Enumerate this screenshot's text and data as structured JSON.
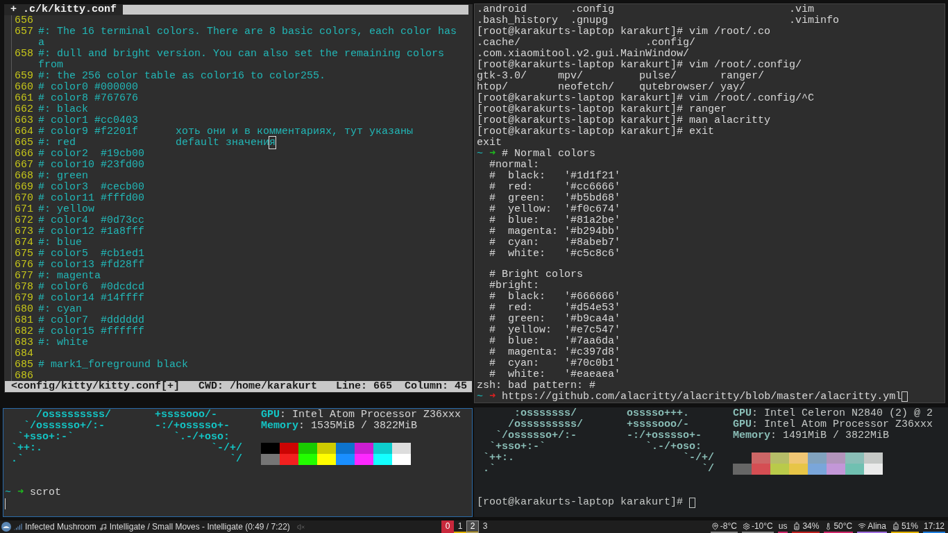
{
  "editor": {
    "tab": "+ .c/k/kitty.conf",
    "lines": [
      {
        "number": "656"
      },
      {
        "number": "657",
        "text": "#: The 16 terminal colors. There are 8 basic colors, each color has a"
      },
      {
        "number": "658",
        "text": "#: dull and bright version. You can also set the remaining colors from"
      },
      {
        "number": "659",
        "text": "#: the 256 color table as color16 to color255."
      },
      {
        "number": "660",
        "text": "# color0 #000000"
      },
      {
        "number": "661",
        "text": "# color8 #767676"
      },
      {
        "number": "662",
        "text": "#: black"
      },
      {
        "number": "663",
        "text": "# color1 #cc0403"
      },
      {
        "number": "664",
        "text": "# color9 #f2201f      хоть они и в комментариях, тут указаны"
      },
      {
        "number": "665",
        "text": "#: red                default значения",
        "cursor": true
      },
      {
        "number": "666",
        "text": "# color2  #19cb00"
      },
      {
        "number": "667",
        "text": "# color10 #23fd00"
      },
      {
        "number": "668",
        "text": "#: green"
      },
      {
        "number": "669",
        "text": "# color3  #cecb00"
      },
      {
        "number": "670",
        "text": "# color11 #fffd00"
      },
      {
        "number": "671",
        "text": "#: yellow"
      },
      {
        "number": "672",
        "text": "# color4  #0d73cc"
      },
      {
        "number": "673",
        "text": "# color12 #1a8fff"
      },
      {
        "number": "674",
        "text": "#: blue"
      },
      {
        "number": "675",
        "text": "# color5  #cb1ed1"
      },
      {
        "number": "676",
        "text": "# color13 #fd28ff"
      },
      {
        "number": "677",
        "text": "#: magenta"
      },
      {
        "number": "678",
        "text": "# color6  #0dcdcd"
      },
      {
        "number": "679",
        "text": "# color14 #14ffff"
      },
      {
        "number": "680",
        "text": "#: cyan"
      },
      {
        "number": "681",
        "text": "# color7  #dddddd"
      },
      {
        "number": "682",
        "text": "# color15 #ffffff"
      },
      {
        "number": "683",
        "text": "#: white"
      },
      {
        "number": "684"
      },
      {
        "number": "685",
        "text": "# mark1_foreground black"
      },
      {
        "number": "686"
      }
    ],
    "status": "<config/kitty/kitty.conf[+]   CWD: /home/karakurt   Line: 665  Column: 45"
  },
  "terminal": {
    "lines": [
      {
        "kind": "plain",
        "text": ".android       .config                            .vim"
      },
      {
        "kind": "plain",
        "text": ".bash_history  .gnupg                             .viminfo"
      },
      {
        "kind": "plain",
        "text": "[root@karakurts-laptop karakurt]# vim /root/.co"
      },
      {
        "kind": "plain",
        "text": ".cache/                    .config/"
      },
      {
        "kind": "plain",
        "text": ".com.xiaomitool.v2.gui.MainWindow/"
      },
      {
        "kind": "plain",
        "text": "[root@karakurts-laptop karakurt]# vim /root/.config/"
      },
      {
        "kind": "plain",
        "text": "gtk-3.0/     mpv/         pulse/       ranger/"
      },
      {
        "kind": "plain",
        "text": "htop/        neofetch/    qutebrowser/ yay/"
      },
      {
        "kind": "plain",
        "text": "[root@karakurts-laptop karakurt]# vim /root/.config/^C"
      },
      {
        "kind": "plain",
        "text": "[root@karakurts-laptop karakurt]# ranger"
      },
      {
        "kind": "plain",
        "text": "[root@karakurts-laptop karakurt]# man alacritty"
      },
      {
        "kind": "plain",
        "text": "[root@karakurts-laptop karakurt]# exit"
      },
      {
        "kind": "plain",
        "text": "exit"
      },
      {
        "kind": "prompt",
        "dir": "~",
        "arrow": "➜",
        "color": "#1fb81f",
        "command": "# Normal colors",
        "cursor": false
      },
      {
        "kind": "plain",
        "text": "  #normal:"
      },
      {
        "kind": "plain",
        "text": "  #  black:   '#1d1f21'"
      },
      {
        "kind": "plain",
        "text": "  #  red:     '#cc6666'"
      },
      {
        "kind": "plain",
        "text": "  #  green:   '#b5bd68'"
      },
      {
        "kind": "plain",
        "text": "  #  yellow:  '#f0c674'"
      },
      {
        "kind": "plain",
        "text": "  #  blue:    '#81a2be'"
      },
      {
        "kind": "plain",
        "text": "  #  magenta: '#b294bb'"
      },
      {
        "kind": "plain",
        "text": "  #  cyan:    '#8abeb7'"
      },
      {
        "kind": "plain",
        "text": "  #  white:   '#c5c8c6'"
      },
      {
        "kind": "blank"
      },
      {
        "kind": "plain",
        "text": "  # Bright colors"
      },
      {
        "kind": "plain",
        "text": "  #bright:"
      },
      {
        "kind": "plain",
        "text": "  #  black:   '#666666'"
      },
      {
        "kind": "plain",
        "text": "  #  red:     '#d54e53'"
      },
      {
        "kind": "plain",
        "text": "  #  green:   '#b9ca4a'"
      },
      {
        "kind": "plain",
        "text": "  #  yellow:  '#e7c547'"
      },
      {
        "kind": "plain",
        "text": "  #  blue:    '#7aa6da'"
      },
      {
        "kind": "plain",
        "text": "  #  magenta: '#c397d8'"
      },
      {
        "kind": "plain",
        "text": "  #  cyan:    '#70c0b1'"
      },
      {
        "kind": "plain",
        "text": "  #  white:   '#eaeaea'"
      },
      {
        "kind": "plain",
        "text": "zsh: bad pattern: #"
      },
      {
        "kind": "prompt",
        "dir": "~",
        "arrow": "➜",
        "color": "#e02020",
        "command": "https://github.com/alacritty/alacritty/blob/master/alacritty.yml",
        "cursor": true
      }
    ]
  },
  "neofetch_left": {
    "art": [
      "     /osssssssss/       +ssssooo/-",
      "   `/ossssso+/:-        -:/+osssso+-",
      "  `+sso+:-`                `.-/+oso:",
      " `++:.                           `-/+/",
      " .`                                 `/"
    ],
    "info": [
      {
        "label": "GPU",
        "value": ": Intel Atom Processor Z36xxx"
      },
      {
        "label": "Memory",
        "value": ": 1535MiB / 3822MiB"
      }
    ],
    "swatches": [
      [
        {
          "color": "#000000"
        },
        {
          "color": "#cc0403"
        },
        {
          "color": "#19cb00"
        },
        {
          "color": "#cecb00"
        },
        {
          "color": "#0d73cc"
        },
        {
          "color": "#cb1ed1"
        },
        {
          "color": "#0dcdcd"
        },
        {
          "color": "#dddddd"
        }
      ],
      [
        {
          "color": "#767676"
        },
        {
          "color": "#f2201f"
        },
        {
          "color": "#23fd00"
        },
        {
          "color": "#fffd00"
        },
        {
          "color": "#1a8fff"
        },
        {
          "color": "#fd28ff"
        },
        {
          "color": "#14ffff"
        },
        {
          "color": "#ffffff"
        }
      ]
    ],
    "prompt": {
      "dir": "~",
      "arrow": "➜",
      "color": "#1fb81f",
      "command": "scrot"
    },
    "cursor": true
  },
  "neofetch_right": {
    "art": [
      "      :osssssss/        osssso+++.",
      "     /osssssssss/       +ssssooo/-",
      "   `/ossssso+/:-        -:/+osssso+-",
      "  `+sso+:-`                `.-/+oso:",
      " `++:.                           `-/+/",
      " .`                                 `/"
    ],
    "info": [
      {
        "label": "CPU",
        "value": ": Intel Celeron N2840 (2) @ 2"
      },
      {
        "label": "GPU",
        "value": ": Intel Atom Processor Z36xxx"
      },
      {
        "label": "Memory",
        "value": ": 1491MiB / 3822MiB"
      }
    ],
    "swatches": [
      [
        {
          "color": "#1d1f21"
        },
        {
          "color": "#cc6666"
        },
        {
          "color": "#b5bd68"
        },
        {
          "color": "#f0c674"
        },
        {
          "color": "#81a2be"
        },
        {
          "color": "#b294bb"
        },
        {
          "color": "#8abeb7"
        },
        {
          "color": "#c5c8c6"
        }
      ],
      [
        {
          "color": "#666666"
        },
        {
          "color": "#d54e53"
        },
        {
          "color": "#b9ca4a"
        },
        {
          "color": "#e7c547"
        },
        {
          "color": "#7aa6da"
        },
        {
          "color": "#c397d8"
        },
        {
          "color": "#70c0b1"
        },
        {
          "color": "#eaeaea"
        }
      ]
    ],
    "prompt_text": "[root@karakurts-laptop karakurt]# "
  },
  "status_bar": {
    "artist": "Infected Mushroom",
    "track": "Intelligate / Small Moves - Intelligate (0:49 / 7:22)",
    "workspaces": [
      {
        "label": "0",
        "selected": false,
        "urgent": true,
        "occupied": false
      },
      {
        "label": "1",
        "selected": false,
        "urgent": false,
        "occupied": true
      },
      {
        "label": "2",
        "selected": true,
        "urgent": false,
        "occupied": true
      },
      {
        "label": "3",
        "selected": false,
        "urgent": false,
        "occupied": false
      }
    ],
    "right": [
      {
        "kind": "location",
        "text": "-8°C",
        "color": "#888888"
      },
      {
        "kind": "gear",
        "text": "-10°C",
        "color": "#888888"
      },
      {
        "kind": "keyboard",
        "text": "us",
        "color": "#d0286a"
      },
      {
        "kind": "battery",
        "text": "34%",
        "color": "#c02020"
      },
      {
        "kind": "thermometer",
        "text": "50°C",
        "color": "#d0286a"
      },
      {
        "kind": "wifi",
        "text": "Alina",
        "color": "#a070e0"
      },
      {
        "kind": "battery",
        "text": "51%",
        "color": "#e0b000"
      },
      {
        "kind": "clock",
        "text": "17:12",
        "color": "#2080e0"
      }
    ]
  }
}
